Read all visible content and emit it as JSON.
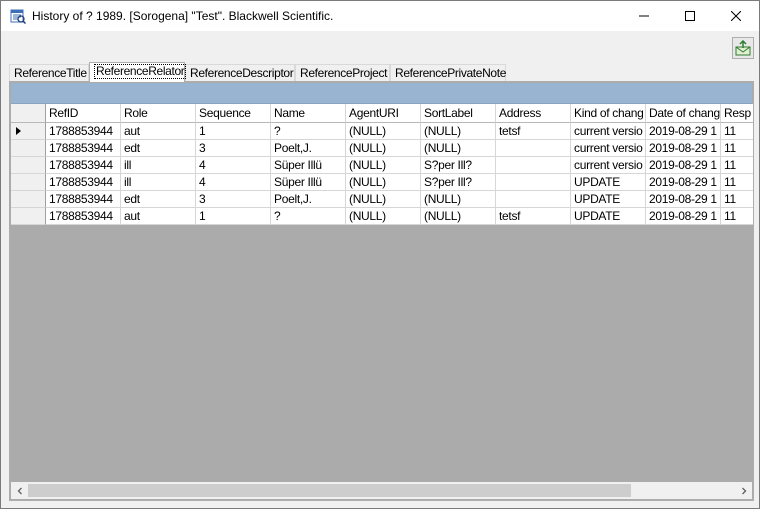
{
  "window": {
    "title": "History of ? 1989. [Sorogena] \"Test\". Blackwell Scientific."
  },
  "tabs": [
    {
      "label": "ReferenceTitle",
      "active": false
    },
    {
      "label": "ReferenceRelator",
      "active": true
    },
    {
      "label": "ReferenceDescriptor",
      "active": false
    },
    {
      "label": "ReferenceProject",
      "active": false
    },
    {
      "label": "ReferencePrivateNote",
      "active": false
    }
  ],
  "grid": {
    "columns": [
      "RefID",
      "Role",
      "Sequence",
      "Name",
      "AgentURI",
      "SortLabel",
      "Address",
      "Kind of chang",
      "Date of chang",
      "Resp"
    ],
    "rows": [
      [
        "1788853944",
        "aut",
        "1",
        "?",
        "(NULL)",
        "(NULL)",
        "tetsf",
        "current versio",
        "2019-08-29 1",
        "11"
      ],
      [
        "1788853944",
        "edt",
        "3",
        "Poelt,J.",
        "(NULL)",
        "(NULL)",
        "",
        "current versio",
        "2019-08-29 1",
        "11"
      ],
      [
        "1788853944",
        "ill",
        "4",
        "Süper Illü",
        "(NULL)",
        "S?per Ill?",
        "",
        "current versio",
        "2019-08-29 1",
        "11"
      ],
      [
        "1788853944",
        "ill",
        "4",
        "Süper Illü",
        "(NULL)",
        "S?per Ill?",
        "",
        "UPDATE",
        "2019-08-29 1",
        "11"
      ],
      [
        "1788853944",
        "edt",
        "3",
        "Poelt,J.",
        "(NULL)",
        "(NULL)",
        "",
        "UPDATE",
        "2019-08-29 1",
        "11"
      ],
      [
        "1788853944",
        "aut",
        "1",
        "?",
        "(NULL)",
        "(NULL)",
        "tetsf",
        "UPDATE",
        "2019-08-29 1",
        "11"
      ]
    ],
    "current_row": 0
  },
  "colors": {
    "caption_bar": "#99b4d1",
    "grid_background": "#ababab"
  },
  "icons": {
    "app": "datagrid-icon",
    "toolbar": "export-icon"
  }
}
